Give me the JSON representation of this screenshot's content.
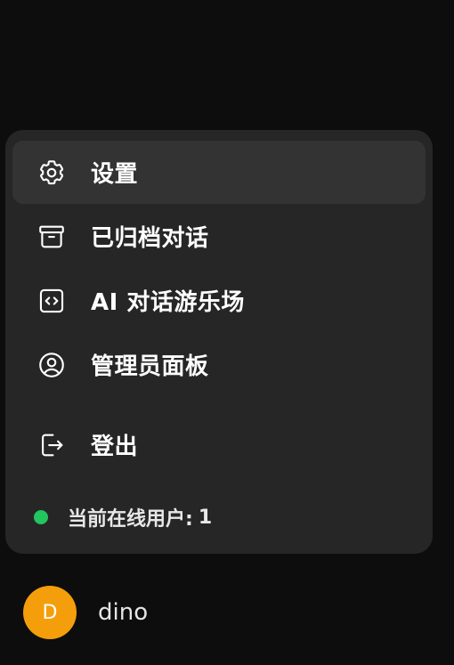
{
  "menu": {
    "items": [
      {
        "label": "设置",
        "icon": "gear-icon"
      },
      {
        "label": "已归档对话",
        "icon": "archive-icon"
      },
      {
        "label": "AI 对话游乐场",
        "icon": "code-icon"
      },
      {
        "label": "管理员面板",
        "icon": "user-circle-icon"
      },
      {
        "label": "登出",
        "icon": "logout-icon"
      }
    ],
    "online_label": "当前在线用户:",
    "online_count": "1"
  },
  "user": {
    "initial": "D",
    "name": "dino"
  },
  "colors": {
    "background": "#0d0d0d",
    "menu_bg": "#262626",
    "active_bg": "#333333",
    "online_dot": "#22c55e",
    "avatar_bg": "#f59e0b"
  }
}
